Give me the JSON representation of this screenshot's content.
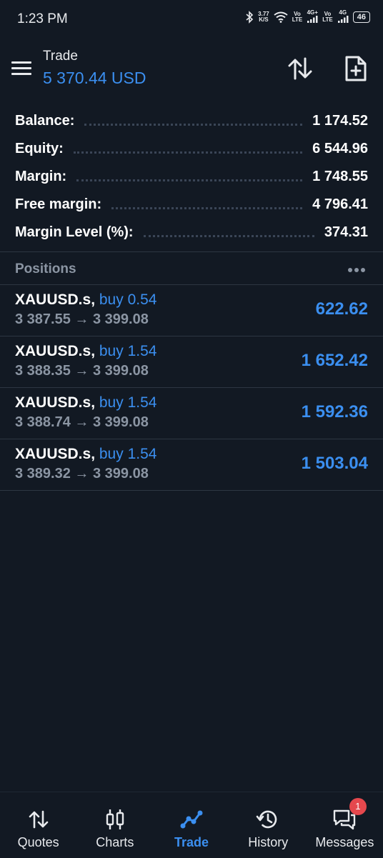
{
  "status_bar": {
    "time": "1:23 PM",
    "speed_value": "3.77",
    "speed_unit": "K/S",
    "sim1_label_top": "Vo",
    "sim1_label_bottom": "LTE",
    "sim1_network": "4G+",
    "sim2_label_top": "Vo",
    "sim2_label_bottom": "LTE",
    "sim2_network": "4G",
    "battery": "46"
  },
  "app_bar": {
    "title": "Trade",
    "balance": "5 370.44 USD"
  },
  "summary": [
    {
      "label": "Balance:",
      "value": "1 174.52"
    },
    {
      "label": "Equity:",
      "value": "6 544.96"
    },
    {
      "label": "Margin:",
      "value": "1 748.55"
    },
    {
      "label": "Free margin:",
      "value": "4 796.41"
    },
    {
      "label": "Margin Level (%):",
      "value": "374.31"
    }
  ],
  "positions": {
    "title": "Positions",
    "items": [
      {
        "symbol": "XAUUSD.s",
        "side": "buy 0.54",
        "prices": "3 387.55 → 3 399.08",
        "profit": "622.62"
      },
      {
        "symbol": "XAUUSD.s",
        "side": "buy 1.54",
        "prices": "3 388.35 → 3 399.08",
        "profit": "1 652.42"
      },
      {
        "symbol": "XAUUSD.s",
        "side": "buy 1.54",
        "prices": "3 388.74 → 3 399.08",
        "profit": "1 592.36"
      },
      {
        "symbol": "XAUUSD.s",
        "side": "buy 1.54",
        "prices": "3 389.32 → 3 399.08",
        "profit": "1 503.04"
      }
    ]
  },
  "nav": {
    "quotes": "Quotes",
    "charts": "Charts",
    "trade": "Trade",
    "history": "History",
    "messages": "Messages",
    "messages_badge": "1"
  },
  "colors": {
    "background": "#121923",
    "accent": "#3b8ff0",
    "muted_text": "#8b95a3",
    "badge": "#e5484d"
  }
}
